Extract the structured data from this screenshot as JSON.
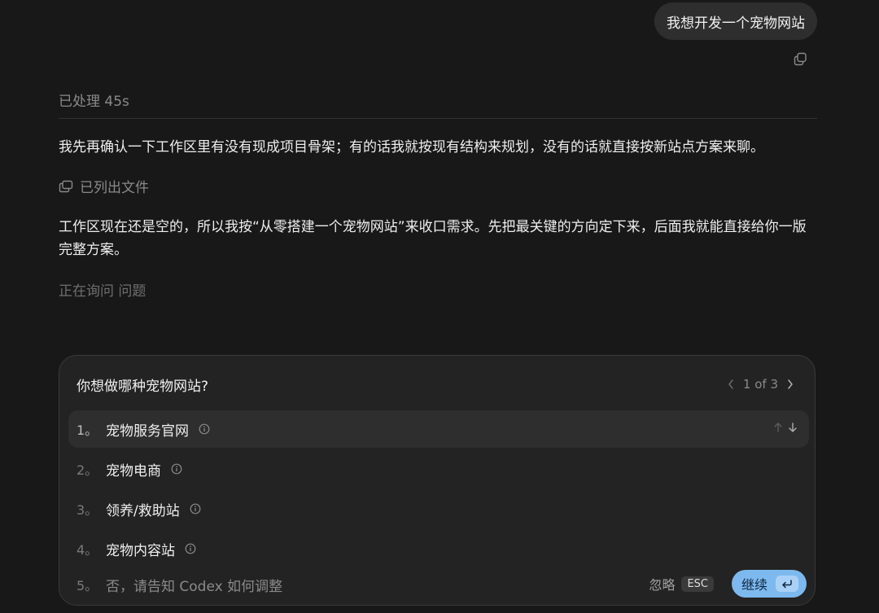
{
  "conversation": {
    "user_message": "我想开发一个宠物网站",
    "processed_label": "已处理",
    "processed_time": "45s",
    "paragraph_1": "我先再确认一下工作区里有没有现成项目骨架；有的话我就按现有结构来规划，没有的话就直接按新站点方案来聊。",
    "action_text": "已列出文件",
    "paragraph_2": "工作区现在还是空的，所以我按“从零搭建一个宠物网站”来收口需求。先把最关键的方向定下来，后面我就能直接给你一版完整方案。",
    "status_text": "正在询问 问题"
  },
  "question_card": {
    "question": "你想做哪种宠物网站?",
    "pager_text": "1 of 3",
    "options": [
      {
        "number": "1。",
        "label": "宠物服务官网"
      },
      {
        "number": "2。",
        "label": "宠物电商"
      },
      {
        "number": "3。",
        "label": "领养/救助站"
      },
      {
        "number": "4。",
        "label": "宠物内容站"
      },
      {
        "number": "5。",
        "label": "否，请告知 Codex 如何调整"
      }
    ],
    "skip_label": "忽略",
    "skip_key": "ESC",
    "continue_label": "继续"
  },
  "icons": {
    "copy": "copy-icon",
    "files": "files-icon",
    "info": "info-icon",
    "chevron_left": "chevron-left-icon",
    "chevron_right": "chevron-right-icon",
    "arrow_up": "arrow-up-icon",
    "arrow_down": "arrow-down-icon",
    "enter": "enter-icon"
  },
  "colors": {
    "background": "#181818",
    "card": "#232323",
    "accent": "#7db9ee"
  }
}
